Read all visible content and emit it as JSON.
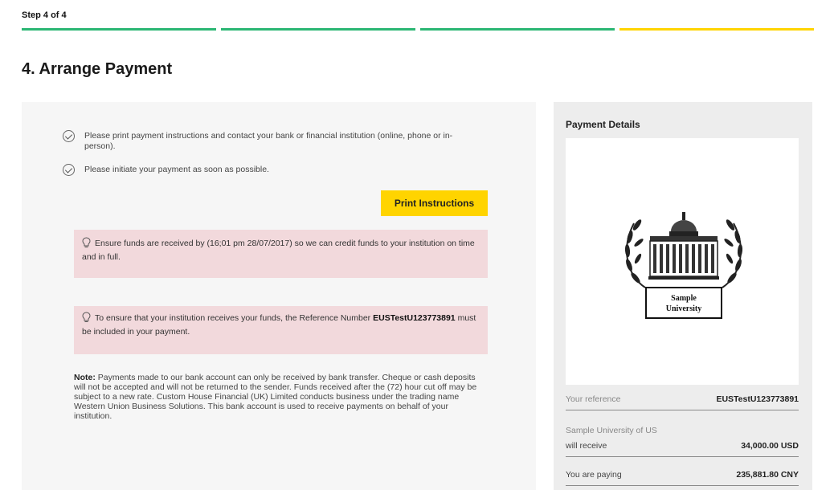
{
  "step": {
    "label": "Step 4 of 4"
  },
  "progress": {
    "segments": [
      {
        "state": "complete",
        "color": "#2bb673"
      },
      {
        "state": "complete",
        "color": "#2bb673"
      },
      {
        "state": "complete",
        "color": "#2bb673"
      },
      {
        "state": "current",
        "color": "#ffd400"
      }
    ]
  },
  "page": {
    "title": "4. Arrange Payment"
  },
  "checklist": [
    {
      "text": "Please print payment instructions and contact your bank or financial institution (online, phone or in-person)."
    },
    {
      "text": "Please initiate your payment as soon as possible."
    }
  ],
  "print_button": {
    "label": "Print Instructions"
  },
  "alerts": {
    "deadline": {
      "text_before": "Ensure funds are received by (16;01 pm 28/07/2017) so we can credit funds to your institution on time and in full."
    },
    "reference": {
      "text_before": "To ensure that your institution receives your funds, the Reference Number ",
      "reference_number": "EUSTestU123773891",
      "text_after": " must be included in your payment."
    }
  },
  "note": {
    "label": "Note:",
    "text": " Payments made to our bank account can only be received by bank transfer. Cheque or cash deposits will not be accepted and will not be returned to the sender. Funds received after the (72) hour cut off may be subject to a new rate. Custom House Financial (UK) Limited conducts business under the trading name Western Union Business Solutions. This bank account is used to receive payments on behalf of your institution."
  },
  "payment_details": {
    "title": "Payment Details",
    "logo_text": [
      "Sample",
      "University"
    ],
    "your_reference": {
      "label": "Your reference",
      "value": "EUSTestU123773891"
    },
    "recipient": "Sample University of US",
    "will_receive": {
      "label": "will receive",
      "value": "34,000.00 USD"
    },
    "you_are_paying": {
      "label": "You are paying",
      "value": "235,881.80 CNY"
    }
  },
  "colors": {
    "accent_yellow": "#ffd400",
    "progress_green": "#2bb673",
    "alert_pink": "#f2d9dc"
  }
}
